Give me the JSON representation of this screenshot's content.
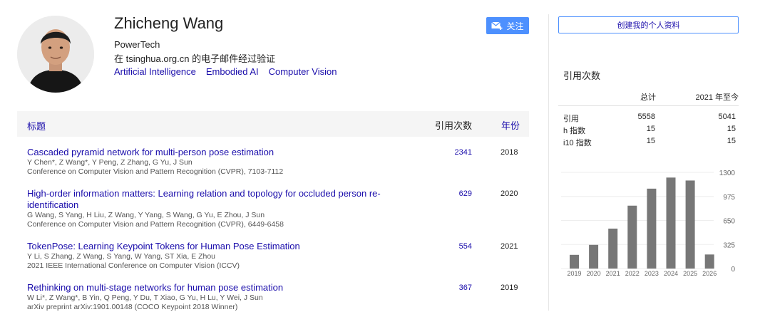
{
  "profile": {
    "name": "Zhicheng Wang",
    "affiliation": "PowerTech",
    "verified": "在 tsinghua.org.cn 的电子邮件经过验证",
    "interests": [
      "Artificial Intelligence",
      "Embodied AI",
      "Computer Vision"
    ],
    "follow_label": "关注"
  },
  "table": {
    "header_title": "标题",
    "header_cites": "引用次数",
    "header_year": "年份",
    "rows": [
      {
        "title": "Cascaded pyramid network for multi-person pose estimation",
        "authors": "Y Chen*, Z Wang*, Y Peng, Z Zhang, G Yu, J Sun",
        "venue": "Conference on Computer Vision and Pattern Recognition (CVPR), 7103-7112",
        "cites": "2341",
        "year": "2018"
      },
      {
        "title": "High-order information matters: Learning relation and topology for occluded person re-identification",
        "authors": "G Wang, S Yang, H Liu, Z Wang, Y Yang, S Wang, G Yu, E Zhou, J Sun",
        "venue": "Conference on Computer Vision and Pattern Recognition (CVPR), 6449-6458",
        "cites": "629",
        "year": "2020"
      },
      {
        "title": "TokenPose: Learning Keypoint Tokens for Human Pose Estimation",
        "authors": "Y Li, S Zhang, Z Wang, S Yang, W Yang, ST Xia, E Zhou",
        "venue": "2021 IEEE International Conference on Computer Vision (ICCV)",
        "cites": "554",
        "year": "2021"
      },
      {
        "title": "Rethinking on multi-stage networks for human pose estimation",
        "authors": "W Li*, Z Wang*, B Yin, Q Peng, Y Du, T Xiao, G Yu, H Lu, Y Wei, J Sun",
        "venue": "arXiv preprint arXiv:1901.00148 (COCO Keypoint 2018 Winner)",
        "cites": "367",
        "year": "2019"
      }
    ]
  },
  "sidebar": {
    "create_profile_label": "创建我的个人资料",
    "cited_by_heading": "引用次数",
    "col_all": "总计",
    "col_since": "2021 年至今",
    "stats": [
      {
        "label": "引用",
        "all": "5558",
        "since": "5041"
      },
      {
        "label": "h 指数",
        "all": "15",
        "since": "15"
      },
      {
        "label": "i10 指数",
        "all": "15",
        "since": "15"
      }
    ]
  },
  "chart_data": {
    "type": "bar",
    "categories": [
      "2019",
      "2020",
      "2021",
      "2022",
      "2023",
      "2024",
      "2025",
      "2026"
    ],
    "values": [
      185,
      320,
      540,
      850,
      1080,
      1230,
      1190,
      190
    ],
    "y_ticks": [
      "1300",
      "975",
      "650",
      "325",
      "0"
    ],
    "ylim": [
      0,
      1300
    ],
    "bar_color": "#777777"
  },
  "colors": {
    "link": "#1a0dab",
    "button": "#4d90fe"
  }
}
